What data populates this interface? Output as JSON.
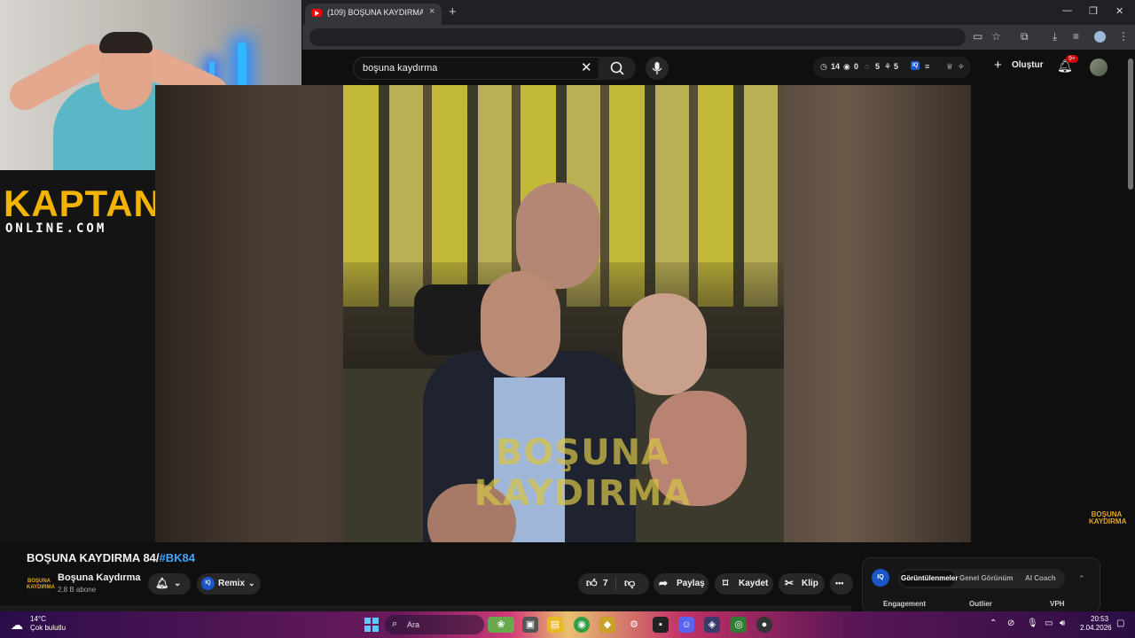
{
  "browser": {
    "tab_title": "(109) BOŞUNA KAYDIRMA 84/#BK84 - YouTube",
    "tab_close": "×",
    "new_tab": "+",
    "window_minimize": "—",
    "window_restore": "❐",
    "window_close": "✕"
  },
  "overlay": {
    "brand_line1": "KAPTAN",
    "brand_line2": "ONLINE.COM"
  },
  "youtube": {
    "search": {
      "value": "boşuna kaydırma",
      "clear_icon": "✕",
      "search_icon": "⌕",
      "mic_icon": "🎙"
    },
    "stats": {
      "views_count": "14",
      "eye_count": "0",
      "comments_count": "5",
      "subs_count": "5",
      "iq_label": "IQ"
    },
    "create_label": "Oluştur",
    "notifications_badge": "9+",
    "video": {
      "watermark_line1": "BOŞUNA",
      "watermark_line2": "KAYDIRMA",
      "corner_logo": "BOŞUNA KAYDIRMA"
    },
    "title_main": "BOŞUNA KAYDIRMA 84/",
    "title_tag": "#BK84",
    "channel": {
      "logo_text": "BOŞUNA KAYDIRMA",
      "name": "Boşuna Kaydırma",
      "subscribers": "2,8 B abone"
    },
    "actions": {
      "remix_label": "Remix",
      "like_count": "7",
      "share_label": "Paylaş",
      "save_label": "Kaydet",
      "clip_label": "Klip",
      "more_label": "•••"
    },
    "side_panel": {
      "iq_label": "IQ",
      "tabs": [
        "Görüntülenmeler",
        "Genel Görünüm",
        "AI Coach"
      ],
      "columns": [
        "Engagement",
        "Outlier",
        "VPH"
      ]
    }
  },
  "taskbar": {
    "weather_temp": "14°C",
    "weather_desc": "Çok bulutlu",
    "search_label": "Ara",
    "time": "20:53",
    "date": "2.04.2026"
  }
}
